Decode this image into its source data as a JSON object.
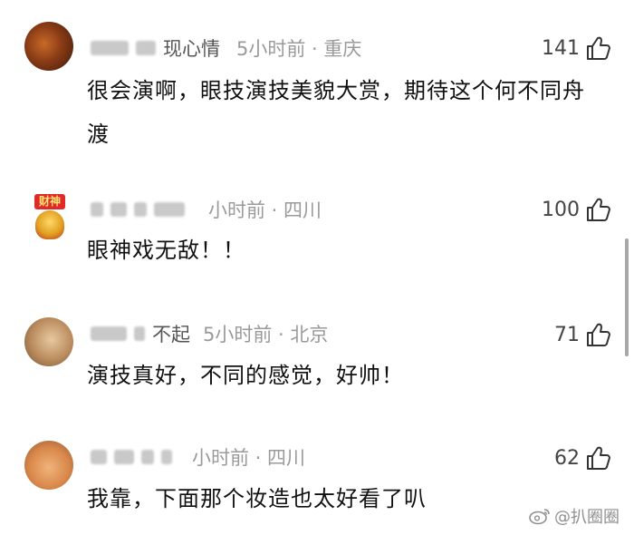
{
  "comments": [
    {
      "username_tail": "现心情",
      "meta": "5小时前 · 重庆",
      "likes": "141",
      "text": "很会演啊，眼技演技美貌大赏，期待这个何不同舟渡"
    },
    {
      "avatar_badge": "财神",
      "username_tail": "",
      "meta": "小时前 · 四川",
      "likes": "100",
      "text": "眼神戏无敌！！"
    },
    {
      "username_tail": "不起",
      "meta": "5小时前 · 北京",
      "likes": "71",
      "text": "演技真好，不同的感觉，好帅！"
    },
    {
      "username_tail": "",
      "meta": "小时前 · 四川",
      "likes": "62",
      "text": "我靠，下面那个妆造也太好看了叭"
    }
  ],
  "watermark": "@扒圈圈",
  "icons": {
    "like": "thumbs-up-icon",
    "watermark": "weibo-icon"
  },
  "colors": {
    "text": "#111111",
    "meta": "#9a9a9a",
    "badge": "#e02a2a"
  }
}
